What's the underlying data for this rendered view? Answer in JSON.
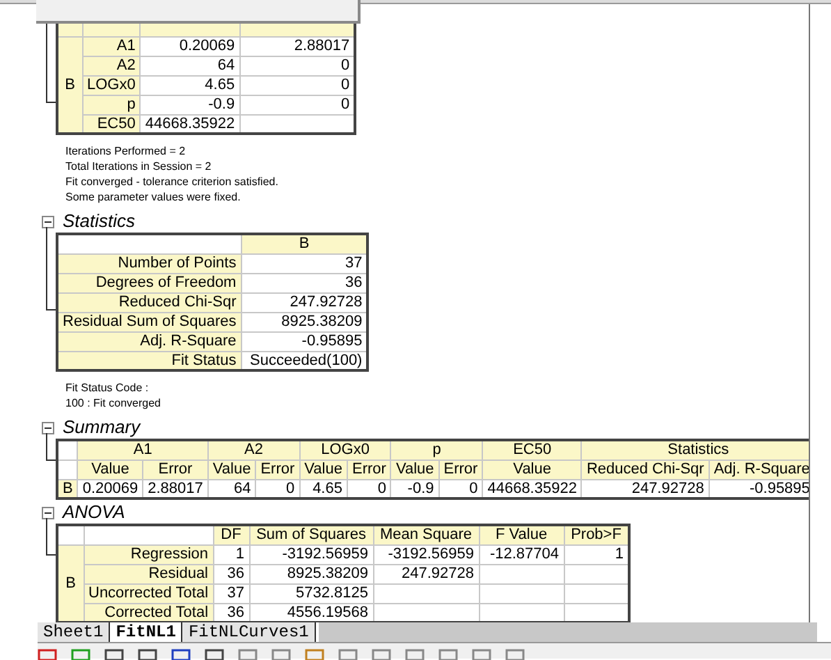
{
  "parameters": {
    "group": "B",
    "rows": [
      {
        "label": "A1",
        "value": "0.20069",
        "error": "2.88017"
      },
      {
        "label": "A2",
        "value": "64",
        "error": "0"
      },
      {
        "label": "LOGx0",
        "value": "4.65",
        "error": "0"
      },
      {
        "label": "p",
        "value": "-0.9",
        "error": "0"
      },
      {
        "label": "EC50",
        "value": "44668.35922"
      }
    ]
  },
  "notes": [
    "Iterations Performed = 2",
    "Total Iterations in Session = 2",
    "Fit converged - tolerance criterion satisfied.",
    "Some parameter values were fixed."
  ],
  "statistics": {
    "title": "Statistics",
    "expanded": true,
    "column": "B",
    "rows": [
      {
        "label": "Number of Points",
        "value": "37"
      },
      {
        "label": "Degrees of Freedom",
        "value": "36"
      },
      {
        "label": "Reduced Chi-Sqr",
        "value": "247.92728"
      },
      {
        "label": "Residual Sum of Squares",
        "value": "8925.38209"
      },
      {
        "label": "Adj. R-Square",
        "value": "-0.95895"
      },
      {
        "label": "Fit Status",
        "value": "Succeeded(100)"
      }
    ]
  },
  "fit_status_notes": [
    "Fit Status Code :",
    "100 : Fit converged"
  ],
  "summary": {
    "title": "Summary",
    "expanded": true,
    "groups": [
      {
        "label": "A1",
        "columns": [
          "Value",
          "Error"
        ]
      },
      {
        "label": "A2",
        "columns": [
          "Value",
          "Error"
        ]
      },
      {
        "label": "LOGx0",
        "columns": [
          "Value",
          "Error"
        ]
      },
      {
        "label": "p",
        "columns": [
          "Value",
          "Error"
        ]
      },
      {
        "label": "EC50",
        "columns": [
          "Value"
        ]
      },
      {
        "label": "Statistics",
        "columns": [
          "Reduced Chi-Sqr",
          "Adj. R-Square"
        ]
      }
    ],
    "rows": [
      {
        "label": "B",
        "cells": [
          "0.20069",
          "2.88017",
          "64",
          "0",
          "4.65",
          "0",
          "-0.9",
          "0",
          "44668.35922",
          "247.92728",
          "-0.95895"
        ]
      }
    ]
  },
  "anova": {
    "title": "ANOVA",
    "expanded": true,
    "group": "B",
    "columns": [
      "DF",
      "Sum of Squares",
      "Mean Square",
      "F Value",
      "Prob>F"
    ],
    "rows": [
      {
        "label": "Regression",
        "cells": [
          "1",
          "-3192.56959",
          "-3192.56959",
          "-12.87704",
          "1"
        ]
      },
      {
        "label": "Residual",
        "cells": [
          "36",
          "8925.38209",
          "247.92728"
        ]
      },
      {
        "label": "Uncorrected Total",
        "cells": [
          "37",
          "5732.8125"
        ]
      },
      {
        "label": "Corrected Total",
        "cells": [
          "36",
          "4556.19568"
        ]
      }
    ]
  },
  "sheet_tabs": [
    {
      "label": "Sheet1",
      "selected": false
    },
    {
      "label": "FitNL1",
      "selected": true
    },
    {
      "label": "FitNLCurves1",
      "selected": false
    }
  ]
}
